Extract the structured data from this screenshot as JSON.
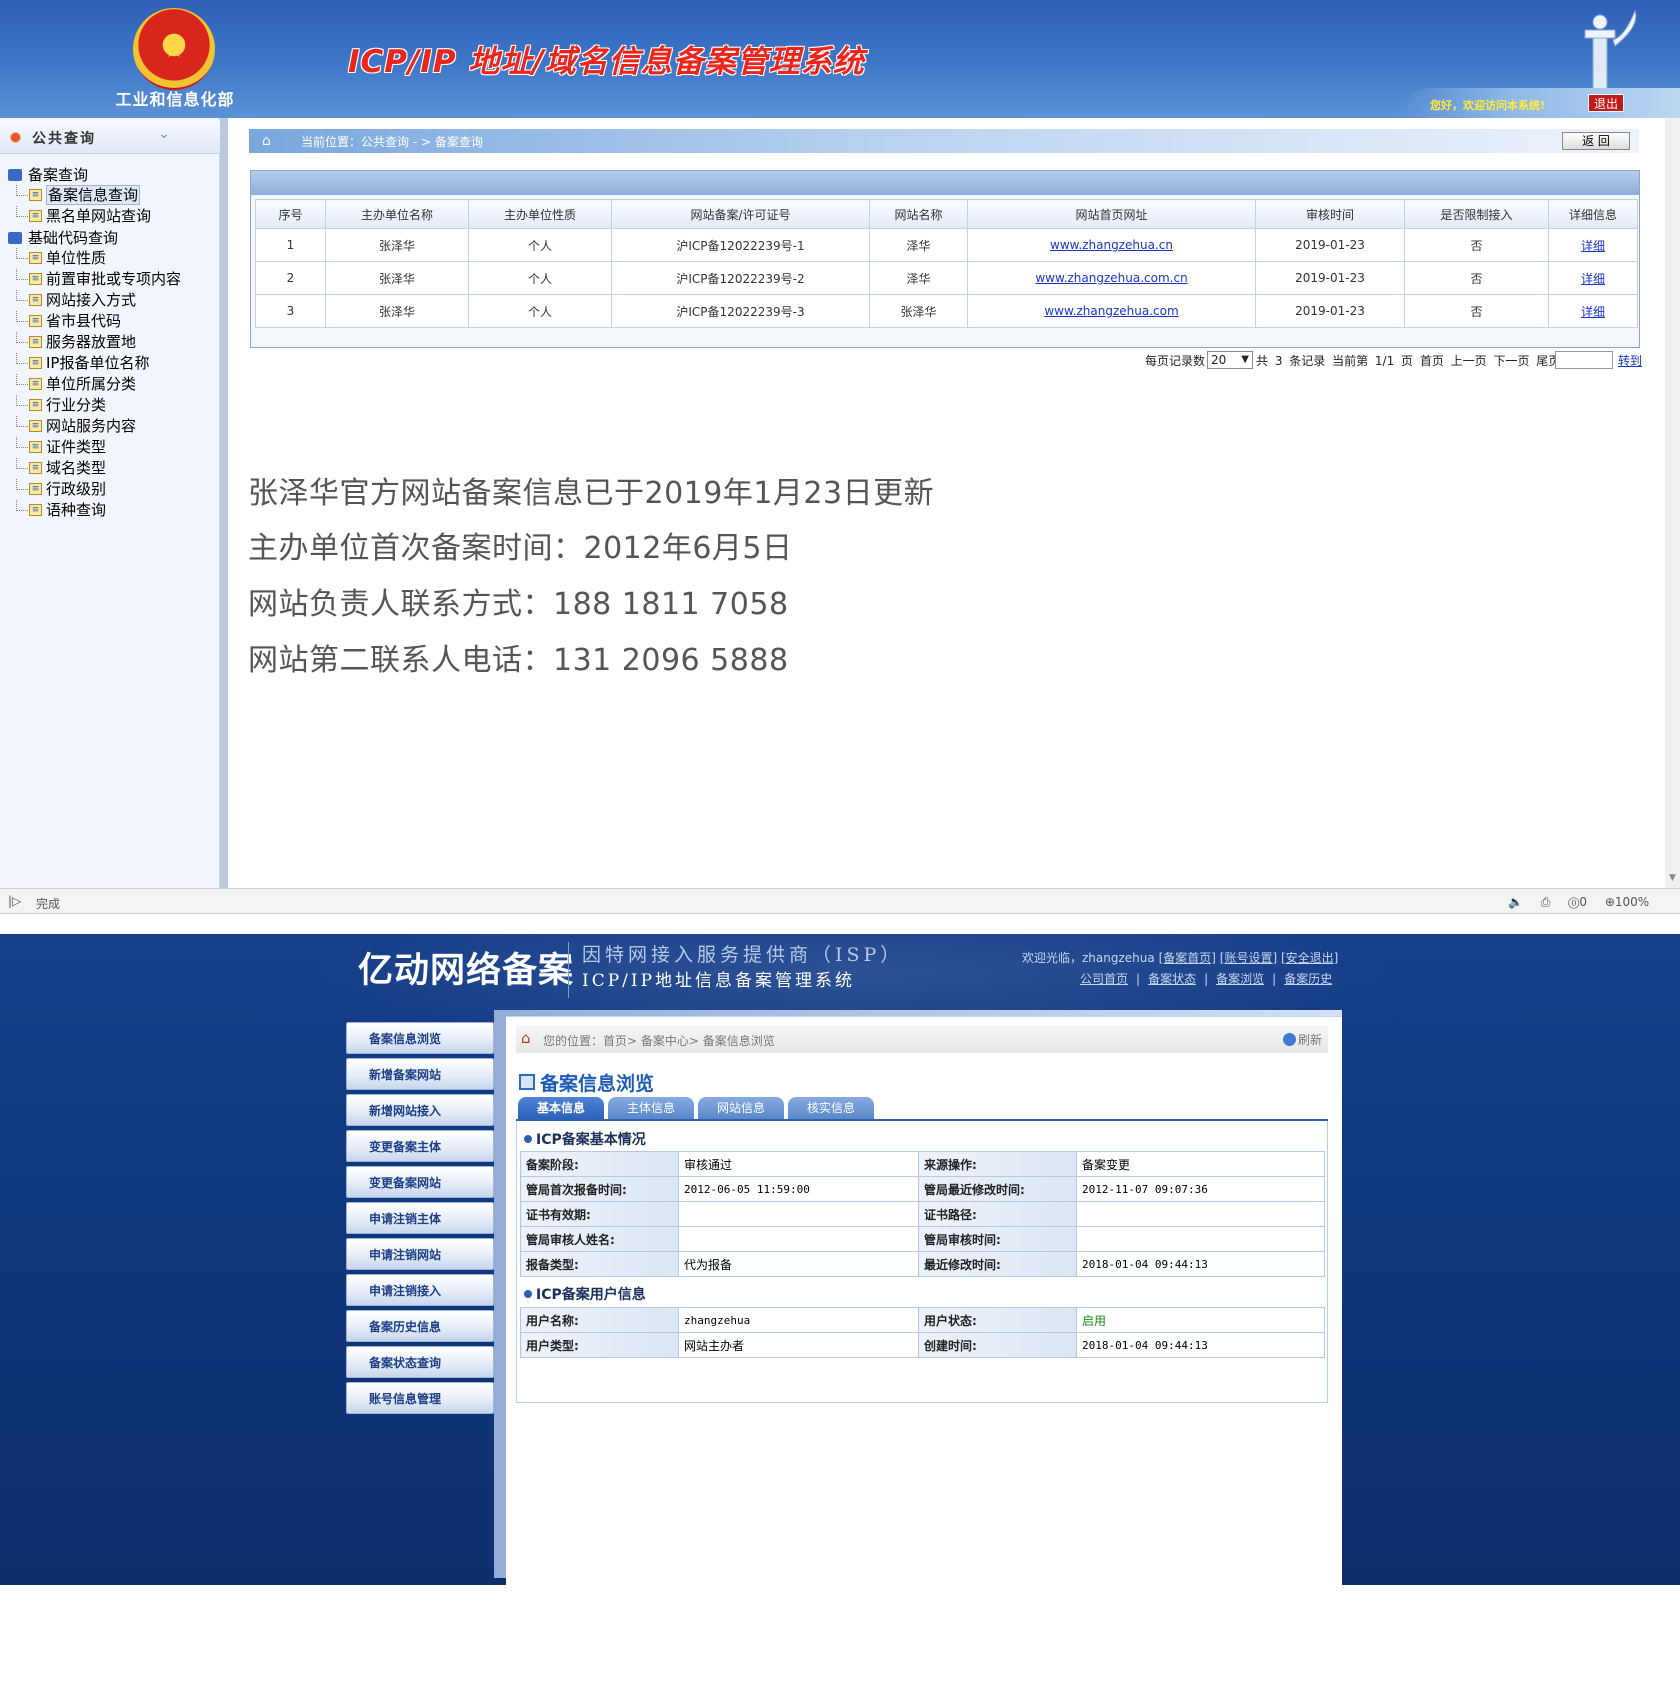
{
  "top": {
    "banner": {
      "title": "ICP/IP 地址/域名信息备案管理系统",
      "ministry": "工业和信息化部",
      "welcome": "您好，欢迎访问本系统!",
      "logout": "退出"
    },
    "nav": {
      "header": "公共查询",
      "groups": [
        {
          "label": "备案查询",
          "items": [
            "备案信息查询",
            "黑名单网站查询"
          ]
        },
        {
          "label": "基础代码查询",
          "items": [
            "单位性质",
            "前置审批或专项内容",
            "网站接入方式",
            "省市县代码",
            "服务器放置地",
            "IP报备单位名称",
            "单位所属分类",
            "行业分类",
            "网站服务内容",
            "证件类型",
            "域名类型",
            "行政级别",
            "语种查询"
          ]
        }
      ]
    },
    "breadcrumb": "当前位置：公共查询  - >  备案查询",
    "back_button": "返  回",
    "table": {
      "headers": [
        "序号",
        "主办单位名称",
        "主办单位性质",
        "网站备案/许可证号",
        "网站名称",
        "网站首页网址",
        "审核时间",
        "是否限制接入",
        "详细信息"
      ],
      "rows": [
        [
          "1",
          "张泽华",
          "个人",
          "沪ICP备12022239号-1",
          "泽华",
          "www.zhangzehua.cn",
          "2019-01-23",
          "否",
          "详细"
        ],
        [
          "2",
          "张泽华",
          "个人",
          "沪ICP备12022239号-2",
          "泽华",
          "www.zhangzehua.com.cn",
          "2019-01-23",
          "否",
          "详细"
        ],
        [
          "3",
          "张泽华",
          "个人",
          "沪ICP备12022239号-3",
          "张泽华",
          "www.zhangzehua.com",
          "2019-01-23",
          "否",
          "详细"
        ]
      ]
    },
    "pager": {
      "per_page_label": "每页记录数",
      "per_page_value": "20",
      "summary": "共 3 条记录  当前第 1/1 页 首页 上一页 下一页 尾页",
      "go": "转到"
    },
    "captions": [
      "张泽华官方网站备案信息已于2019年1月23日更新",
      "主办单位首次备案时间：2012年6月5日",
      "网站负责人联系方式：188 1811 7058",
      "网站第二联系人电话：131 2096 5888"
    ],
    "statusbar": {
      "status": "完成",
      "right": "🔈 ⎙ ⓪0 ⊕100%"
    }
  },
  "bottom": {
    "brand": "亿动网络备案",
    "subtitle1": "因特网接入服务提供商（ISP）",
    "subtitle2": "ICP/IP地址信息备案管理系统",
    "welcome": "欢迎光临，zhangzehua",
    "welcome_links": [
      "[备案首页]",
      "[账号设置]",
      "[安全退出]"
    ],
    "top_links": [
      "公司首页",
      "备案状态",
      "备案浏览",
      "备案历史"
    ],
    "sidebar": [
      "备案信息浏览",
      "新增备案网站",
      "新增网站接入",
      "变更备案主体",
      "变更备案网站",
      "申请注销主体",
      "申请注销网站",
      "申请注销接入",
      "备案历史信息",
      "备案状态查询",
      "账号信息管理"
    ],
    "crumb": "您的位置：首页> 备案中心> 备案信息浏览",
    "refresh": "刷新",
    "title": "备案信息浏览",
    "tabs": [
      "基本信息",
      "主体信息",
      "网站信息",
      "核实信息"
    ],
    "section1": {
      "title": "ICP备案基本情况",
      "rows": [
        [
          "备案阶段:",
          "审核通过",
          "来源操作:",
          "备案变更"
        ],
        [
          "管局首次报备时间:",
          "2012-06-05 11:59:00",
          "管局最近修改时间:",
          "2012-11-07 09:07:36"
        ],
        [
          "证书有效期:",
          "",
          "证书路径:",
          ""
        ],
        [
          "管局审核人姓名:",
          "",
          "管局审核时间:",
          ""
        ],
        [
          "报备类型:",
          "代为报备",
          "最近修改时间:",
          "2018-01-04 09:44:13"
        ]
      ]
    },
    "section2": {
      "title": "ICP备案用户信息",
      "rows": [
        [
          "用户名称:",
          "zhangzehua",
          "用户状态:",
          "启用"
        ],
        [
          "用户类型:",
          "网站主办者",
          "创建时间:",
          "2018-01-04 09:44:13"
        ]
      ]
    }
  }
}
